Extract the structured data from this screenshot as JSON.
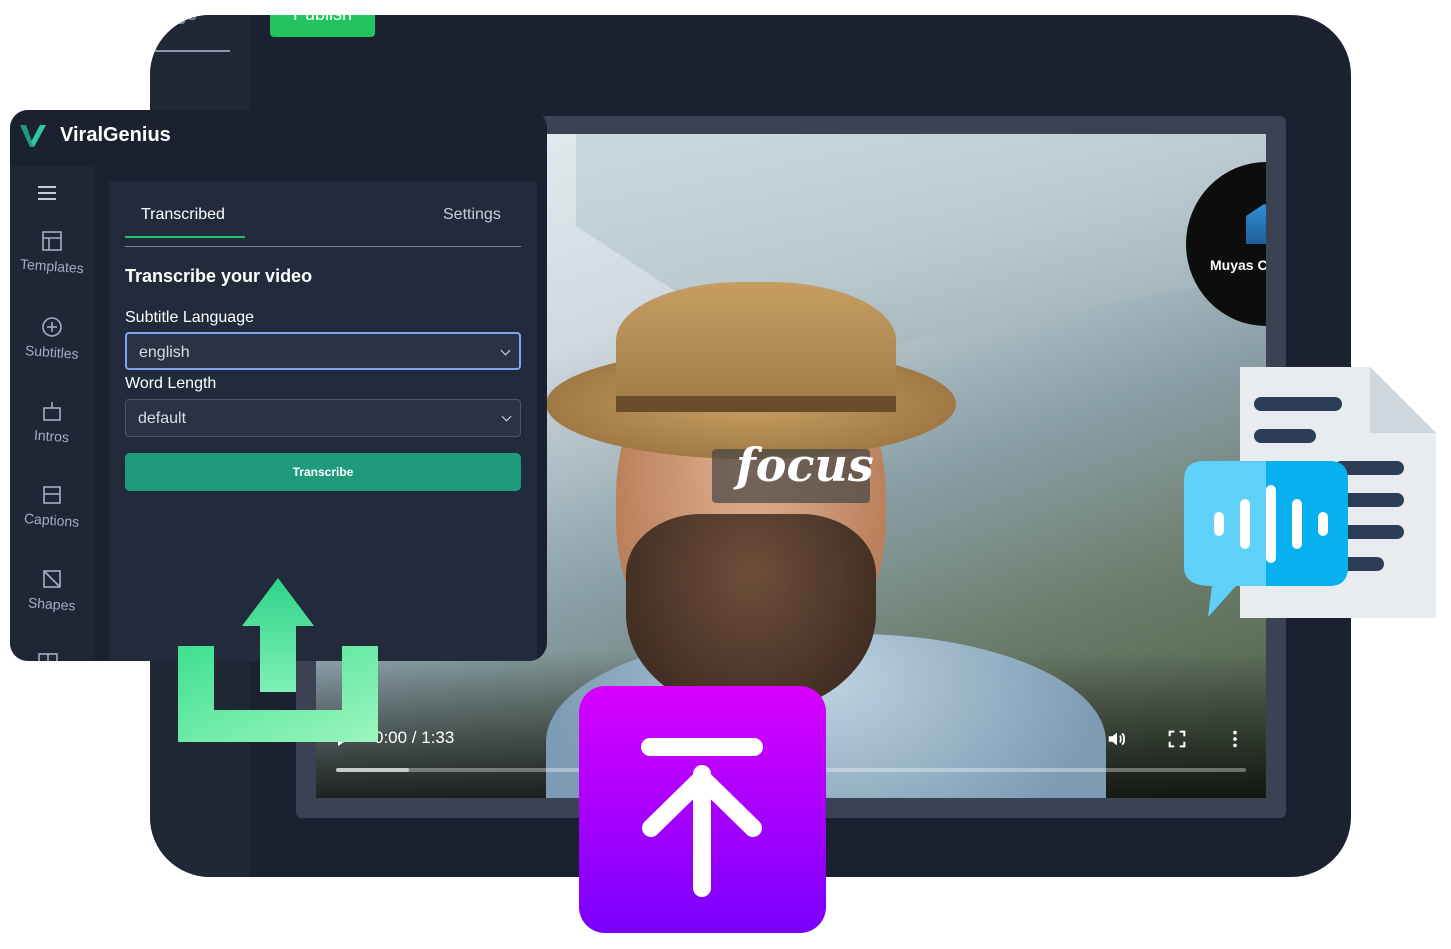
{
  "back_editor": {
    "tab_label": "ings",
    "publish_label": "Publish"
  },
  "video": {
    "caption_word": "focus",
    "logo_text": "Muyas C",
    "time": "0:00 / 1:33",
    "duration": "1:33",
    "buffered_fraction": 0.08
  },
  "app": {
    "brand": "ViralGenius",
    "accent": "#22c35e"
  },
  "sidebar": {
    "items": [
      {
        "label": "Templates",
        "icon": "layout-icon"
      },
      {
        "label": "Subtitles",
        "icon": "plus-circle-icon"
      },
      {
        "label": "Intros",
        "icon": "intro-icon"
      },
      {
        "label": "Captions",
        "icon": "caption-icon"
      },
      {
        "label": "Shapes",
        "icon": "shape-icon"
      }
    ]
  },
  "panel": {
    "tabs": [
      {
        "label": "Transcribed",
        "active": true
      },
      {
        "label": "Settings",
        "active": false
      }
    ],
    "title": "Transcribe your video",
    "subtitle_language": {
      "label": "Subtitle Language",
      "value": "english"
    },
    "word_length": {
      "label": "Word Length",
      "value": "default"
    },
    "transcribe_label": "Transcribe"
  }
}
